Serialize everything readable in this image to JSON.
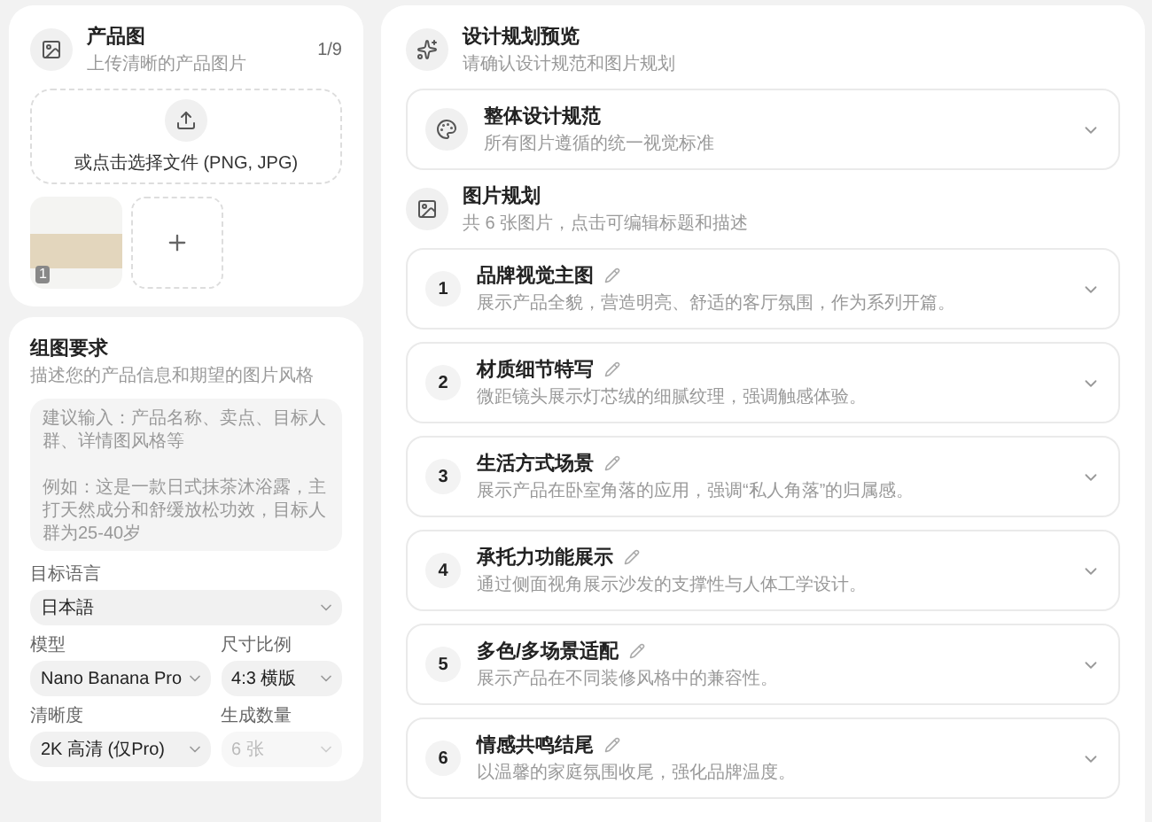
{
  "product_images": {
    "title": "产品图",
    "subtitle": "上传清晰的产品图片",
    "count": "1/9",
    "upload_label": "或点击选择文件 (PNG, JPG)",
    "thumbnails": [
      {
        "badge": "1"
      }
    ]
  },
  "requirements": {
    "title": "组图要求",
    "subtitle": "描述您的产品信息和期望的图片风格",
    "placeholder": [
      "建议输入：产品名称、卖点、目标人群、详情图风格等",
      "例如：这是一款日式抹茶沐浴露，主打天然成分和舒缓放松功效，目标人群为25-40岁"
    ],
    "fields": [
      {
        "label": "目标语言",
        "value": "日本語",
        "disabled": false,
        "wide": true
      },
      {
        "label": "模型",
        "value": "Nano Banana Pro",
        "disabled": false,
        "wide": false
      },
      {
        "label": "尺寸比例",
        "value": "4:3 横版",
        "disabled": false,
        "wide": false
      },
      {
        "label": "清晰度",
        "value": "2K 高清 (仅Pro)",
        "disabled": false,
        "wide": false
      },
      {
        "label": "生成数量",
        "value": "6 张",
        "disabled": true,
        "wide": false
      }
    ]
  },
  "preview": {
    "title": "设计规划预览",
    "subtitle": "请确认设计规范和图片规划",
    "spec": {
      "title": "整体设计规范",
      "subtitle": "所有图片遵循的统一视觉标准",
      "expanded": false
    },
    "plan": {
      "title": "图片规划",
      "subtitle": "共 6 张图片，点击可编辑标题和描述",
      "items": [
        {
          "number": "1",
          "title": "品牌视觉主图",
          "description": "展示产品全貌，营造明亮、舒适的客厅氛围，作为系列开篇。",
          "expanded": false
        },
        {
          "number": "2",
          "title": "材质细节特写",
          "description": "微距镜头展示灯芯绒的细腻纹理，强调触感体验。",
          "expanded": false
        },
        {
          "number": "3",
          "title": "生活方式场景",
          "description": "展示产品在卧室角落的应用，强调“私人角落”的归属感。",
          "expanded": false
        },
        {
          "number": "4",
          "title": "承托力功能展示",
          "description": "通过侧面视角展示沙发的支撑性与人体工学设计。",
          "expanded": false
        },
        {
          "number": "5",
          "title": "多色/多场景适配",
          "description": "展示产品在不同装修风格中的兼容性。",
          "expanded": false
        },
        {
          "number": "6",
          "title": "情感共鸣结尾",
          "description": "以温馨的家庭氛围收尾，强化品牌温度。",
          "expanded": false
        }
      ]
    }
  }
}
